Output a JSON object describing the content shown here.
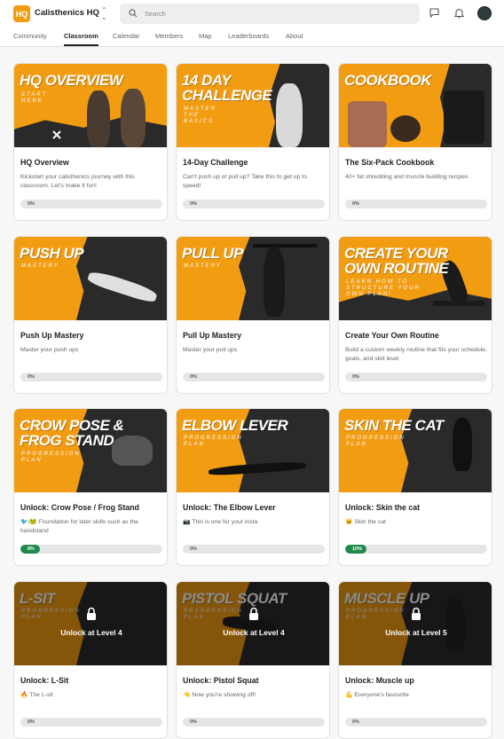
{
  "app": {
    "logo_text": "HQ",
    "name": "Calisthenics HQ"
  },
  "search": {
    "placeholder": "Search"
  },
  "tabs": [
    {
      "label": "Community"
    },
    {
      "label": "Classroom",
      "active": true
    },
    {
      "label": "Calendar"
    },
    {
      "label": "Members"
    },
    {
      "label": "Map"
    },
    {
      "label": "Leaderboards"
    },
    {
      "label": "About"
    }
  ],
  "colors": {
    "brand_orange": "#f29c12",
    "progress_green": "#1f8a4c",
    "dark": "#2a2a2a"
  },
  "courses": [
    {
      "thumb_title": "HQ OVERVIEW",
      "thumb_sub": "START HERE",
      "title": "HQ Overview",
      "desc": "Kickstart your calisthenics journey with this classroom. Let's make it fun!",
      "progress_label": "0%",
      "progress": 0
    },
    {
      "thumb_title": "14 DAY CHALLENGE",
      "thumb_sub": "MASTER THE BASICS",
      "title": "14-Day Challenge",
      "desc": "Can't push up or pull up? Take this to get up to speed!",
      "progress_label": "0%",
      "progress": 0
    },
    {
      "thumb_title": "COOKBOOK",
      "thumb_sub": "",
      "title": "The Six-Pack Cookbook",
      "desc": "40+ fat shredding and muscle building recipes",
      "progress_label": "0%",
      "progress": 0
    },
    {
      "thumb_title": "PUSH UP",
      "thumb_sub": "MASTERY",
      "title": "Push Up Mastery",
      "desc": "Master your push ups",
      "progress_label": "0%",
      "progress": 0
    },
    {
      "thumb_title": "PULL UP",
      "thumb_sub": "MASTERY",
      "title": "Pull Up Mastery",
      "desc": "Master your pull ups",
      "progress_label": "0%",
      "progress": 0
    },
    {
      "thumb_title": "CREATE YOUR OWN ROUTINE",
      "thumb_sub": "LEARN HOW TO STRUCTURE YOUR OWN PLAN!",
      "title": "Create Your Own Routine",
      "desc": "Build a custom weekly routine that fits your schedule, goals, and skill level",
      "progress_label": "0%",
      "progress": 0
    },
    {
      "thumb_title": "CROW POSE & FROG STAND",
      "thumb_sub": "PROGRESSION PLAN",
      "title": "Unlock: Crow Pose / Frog Stand",
      "desc": "🐦/🐸 Foundation for later skills such as the handstand",
      "progress_label": "8%",
      "progress": 8
    },
    {
      "thumb_title": "ELBOW LEVER",
      "thumb_sub": "PROGRESSION PLAN",
      "title": "Unlock: The Elbow Lever",
      "desc": "📷 This is one for your insta",
      "progress_label": "0%",
      "progress": 0
    },
    {
      "thumb_title": "SKIN THE CAT",
      "thumb_sub": "PROGRESSION PLAN",
      "title": "Unlock: Skin the cat",
      "desc": "🐱 Skin the cat",
      "progress_label": "10%",
      "progress": 10
    },
    {
      "thumb_title": "L-SIT",
      "thumb_sub": "PROGRESSION PLAN",
      "title": "Unlock: L-Sit",
      "desc": "🔥 The L-sit",
      "lock_text": "Unlock at Level 4",
      "progress_label": "0%",
      "progress": 0
    },
    {
      "thumb_title": "PISTOL SQUAT",
      "thumb_sub": "PROGRESSION PLAN",
      "title": "Unlock: Pistol Squat",
      "desc": "👈 Now you're showing off!",
      "lock_text": "Unlock at Level 4",
      "progress_label": "0%",
      "progress": 0
    },
    {
      "thumb_title": "MUSCLE UP",
      "thumb_sub": "PROGRESSION PLAN",
      "title": "Unlock: Muscle up",
      "desc": "💪 Everyone's favourite",
      "lock_text": "Unlock at Level 5",
      "progress_label": "0%",
      "progress": 0
    }
  ]
}
